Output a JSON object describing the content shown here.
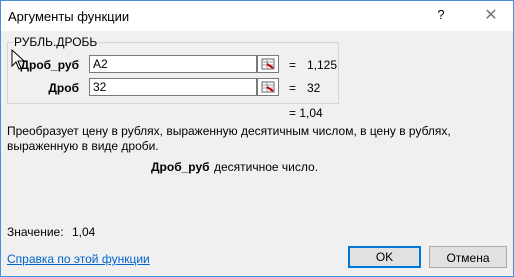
{
  "window": {
    "title": "Аргументы функции",
    "help": "?",
    "close": "✕"
  },
  "function": {
    "name": "РУБЛЬ.ДРОБЬ"
  },
  "args": [
    {
      "label": "Дроб_руб",
      "value": "A2",
      "result": "1,125"
    },
    {
      "label": "Дроб",
      "value": "32",
      "result": "32"
    }
  ],
  "formula_result": "= 1,04",
  "description": "Преобразует цену в рублях, выраженную десятичным числом, в цену в рублях, выраженную в виде дроби.",
  "arg_description": {
    "name": "Дроб_руб",
    "text": "десятичное число."
  },
  "result_row": {
    "label": "Значение:",
    "value": "1,04"
  },
  "help_link": "Справка по этой функции",
  "buttons": {
    "ok": "OK",
    "cancel": "Отмена"
  },
  "equals": "="
}
